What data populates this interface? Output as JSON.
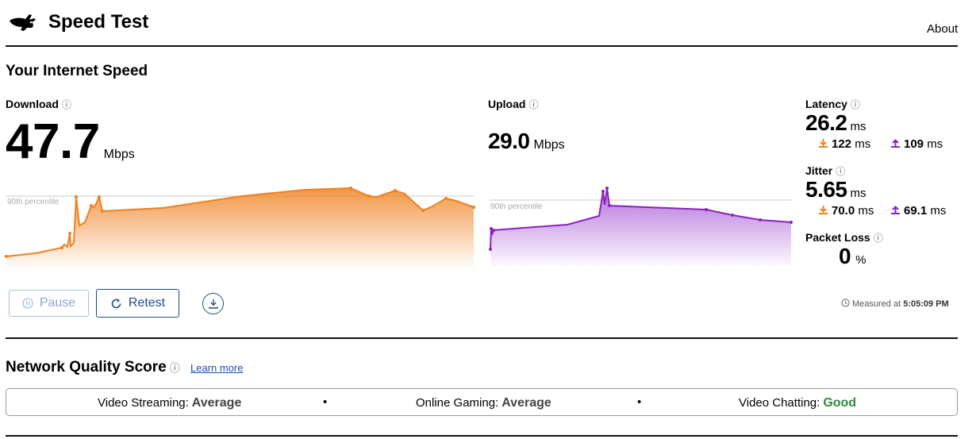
{
  "header": {
    "title": "Speed Test",
    "about_label": "About"
  },
  "speed": {
    "section_title": "Your Internet Speed",
    "info_glyph": "ⓘ"
  },
  "download": {
    "label": "Download",
    "value": "47.7",
    "unit": "Mbps",
    "percentile_label": "90th percentile",
    "color": "#f0801e"
  },
  "upload": {
    "label": "Upload",
    "value": "29.0",
    "unit": "Mbps",
    "percentile_label": "90th percentile",
    "color": "#8a23c0"
  },
  "latency": {
    "label": "Latency",
    "value": "26.2",
    "unit": "ms",
    "down_value": "122",
    "up_value": "109",
    "sub_unit": "ms"
  },
  "jitter": {
    "label": "Jitter",
    "value": "5.65",
    "unit": "ms",
    "down_value": "70.0",
    "up_value": "69.1",
    "sub_unit": "ms"
  },
  "packet_loss": {
    "label": "Packet Loss",
    "value": "0",
    "unit": "%"
  },
  "controls": {
    "pause_label": "Pause",
    "retest_label": "Retest"
  },
  "measured": {
    "prefix": "Measured at",
    "time": "5:05:09 PM"
  },
  "quality": {
    "title": "Network Quality Score",
    "learn_more": "Learn more",
    "items": [
      {
        "label": "Video Streaming:",
        "value": "Average"
      },
      {
        "label": "Online Gaming:",
        "value": "Average"
      },
      {
        "label": "Video Chatting:",
        "value": "Good"
      }
    ],
    "separator": "•",
    "good_color": "#2e8b3e"
  },
  "icons": [
    "rabbit-logo-icon",
    "info-icon",
    "pause-icon",
    "retest-icon",
    "download-results-icon",
    "clock-icon",
    "download-arrow-icon",
    "upload-arrow-icon"
  ]
}
